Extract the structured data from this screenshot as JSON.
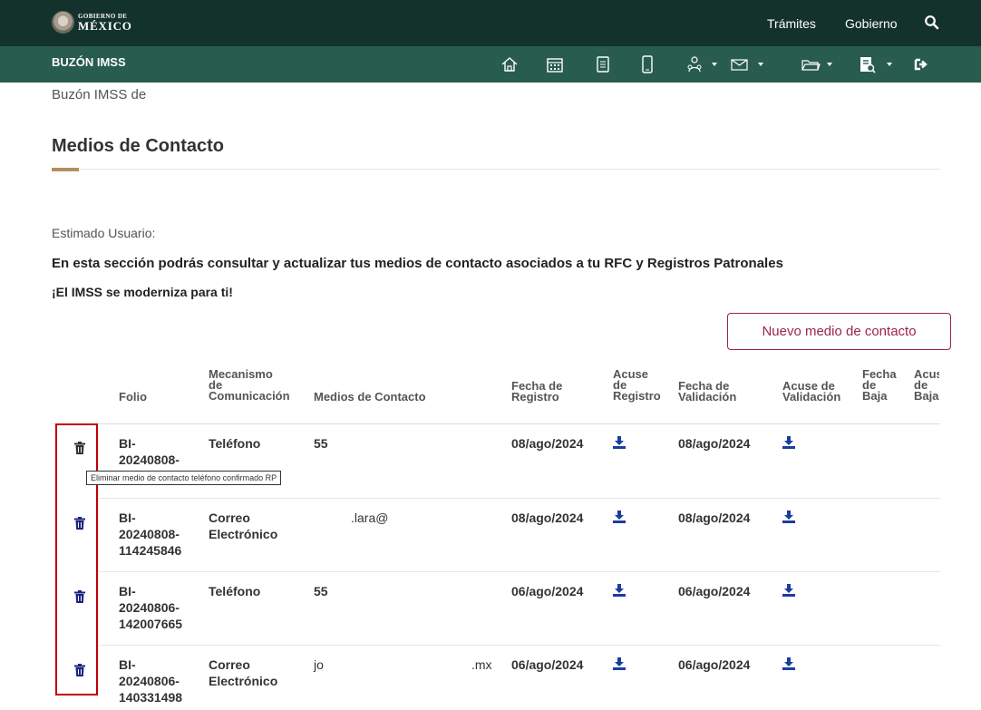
{
  "topnav": {
    "logo_small": "GOBIERNO DE",
    "logo_big": "MÉXICO",
    "links": [
      "Trámites",
      "Gobierno"
    ],
    "search_icon": "search-icon",
    "bg_color": "#13322b"
  },
  "subnav": {
    "title": "BUZÓN IMSS",
    "icons": [
      "home-icon",
      "calendar-icon",
      "document-icon",
      "mobile-icon",
      "users-icon",
      "mail-icon",
      "folder-icon",
      "report-icon",
      "logout-icon"
    ],
    "bg_color": "#285c4d"
  },
  "breadcrumb": "Buzón IMSS de",
  "page": {
    "title": "Medios de Contacto",
    "greeting": "Estimado Usuario:",
    "intro": "En esta sección podrás consultar y actualizar tus medios de contacto asociados a tu RFC y Registros Patronales",
    "slogan": "¡El IMSS se moderniza para ti!",
    "new_button": "Nuevo medio de contacto",
    "accent_color": "#9d2449"
  },
  "table": {
    "headers": {
      "folio": "Folio",
      "mecanismo": [
        "Mecanismo",
        "de",
        "Comunicación"
      ],
      "medios": "Medios de Contacto",
      "fecha_registro": [
        "Fecha de",
        "Registro"
      ],
      "acuse_registro": [
        "Acuse",
        "de",
        "Registro"
      ],
      "fecha_validacion": [
        "Fecha de",
        "Validación"
      ],
      "acuse_validacion": [
        "Acuse de",
        "Validación"
      ],
      "fecha_baja": [
        "Fecha",
        "de",
        "Baja"
      ],
      "acuse_baja": [
        "Acuse",
        "de",
        "Baja"
      ]
    },
    "rows": [
      {
        "folio": [
          "BI-",
          "20240808-"
        ],
        "mecanismo": [
          "Teléfono"
        ],
        "medio_left": "55",
        "medio_right": "",
        "fecha_registro": "08/ago/2024",
        "fecha_validacion": "08/ago/2024"
      },
      {
        "folio": [
          "BI-",
          "20240808-",
          "114245846"
        ],
        "mecanismo": [
          "Correo",
          "Electrónico"
        ],
        "medio_left": "",
        "medio_mid": ".lara@",
        "medio_right": "",
        "fecha_registro": "08/ago/2024",
        "fecha_validacion": "08/ago/2024"
      },
      {
        "folio": [
          "BI-",
          "20240806-",
          "142007665"
        ],
        "mecanismo": [
          "Teléfono"
        ],
        "medio_left": "55",
        "medio_right": "",
        "fecha_registro": "06/ago/2024",
        "fecha_validacion": "06/ago/2024"
      },
      {
        "folio": [
          "BI-",
          "20240806-",
          "140331498"
        ],
        "mecanismo": [
          "Correo",
          "Electrónico"
        ],
        "medio_left": "jo",
        "medio_right": ".mx",
        "fecha_registro": "06/ago/2024",
        "fecha_validacion": "06/ago/2024"
      }
    ],
    "tooltip": "Eliminar medio de contacto teléfono confirmado RP",
    "trash_colors": [
      "#333333",
      "#1a237e",
      "#1a237e",
      "#1a237e"
    ],
    "download_color": "#1a3d9e"
  }
}
